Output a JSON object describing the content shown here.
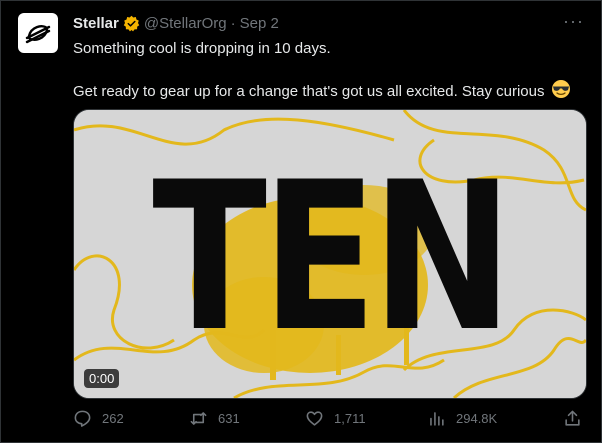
{
  "tweet": {
    "author_name": "Stellar",
    "handle": "@StellarOrg",
    "separator": "·",
    "date": "Sep 2",
    "more_label": "···",
    "line1": "Something cool is dropping in 10 days.",
    "line2": "Get ready to gear up for a change that's got us all excited. Stay curious",
    "emoji": "smiling-face-with-sunglasses"
  },
  "media": {
    "headline": "TEN",
    "timestamp": "0:00",
    "accent_color": "#e3b81c",
    "background_color": "#d6d6d6"
  },
  "actions": {
    "replies": "262",
    "reposts": "631",
    "likes": "1,711",
    "views": "294.8K"
  },
  "colors": {
    "text": "#e7e9ea",
    "muted": "#71767b",
    "verified": "#f4b400"
  }
}
